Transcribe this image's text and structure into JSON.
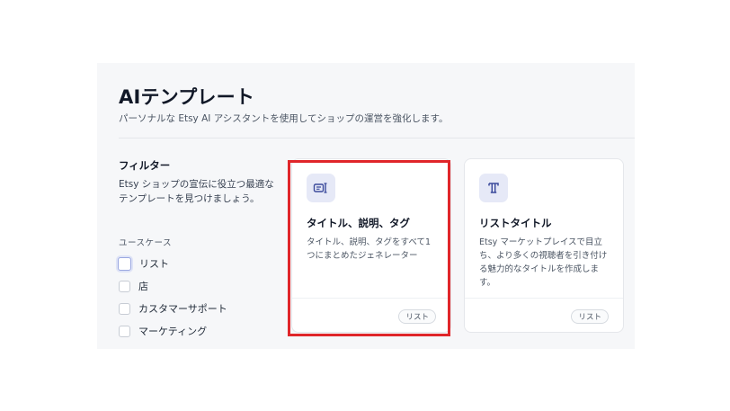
{
  "header": {
    "title": "AIテンプレート",
    "subtitle": "パーソナルな Etsy AI アシスタントを使用してショップの運営を強化します。"
  },
  "filters": {
    "title": "フィルター",
    "description": "Etsy ショップの宣伝に役立つ最適なテンプレートを見つけましょう。",
    "usecase_label": "ユースケース",
    "options": [
      {
        "label": "リスト",
        "checked": false,
        "focused": true
      },
      {
        "label": "店",
        "checked": false
      },
      {
        "label": "カスタマーサポート",
        "checked": false
      },
      {
        "label": "マーケティング",
        "checked": false
      }
    ]
  },
  "cards": [
    {
      "icon": "listing-tag-icon",
      "title": "タイトル、説明、タグ",
      "description": "タイトル、説明、タグをすべて1つにまとめたジェネレーター",
      "tag": "リスト",
      "highlighted": true
    },
    {
      "icon": "title-text-icon",
      "title": "リストタイトル",
      "description": "Etsy マーケットプレイスで目立ち、より多くの視聴者を引き付ける魅力的なタイトルを作成します。",
      "tag": "リスト",
      "highlighted": false
    }
  ],
  "colors": {
    "accent": "#3b4a9c",
    "icon_bg": "#e6e9f7",
    "highlight": "#e0262a"
  }
}
